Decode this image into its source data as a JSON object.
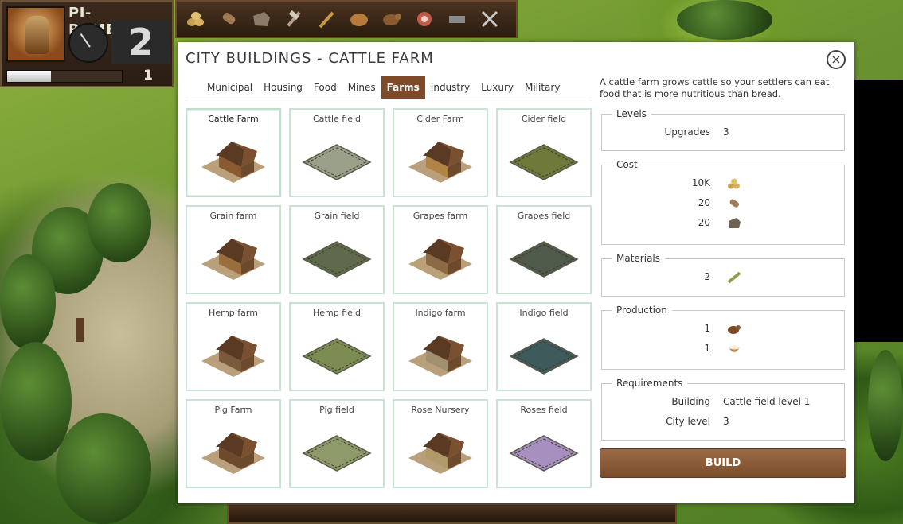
{
  "hud": {
    "city_name": "PI-RAMESSES",
    "level": "2",
    "sub_level": "1",
    "progress": 0.38
  },
  "resources": [
    {
      "name": "wood-logs-icon"
    },
    {
      "name": "log-icon"
    },
    {
      "name": "stone-icon"
    },
    {
      "name": "tools-icon"
    },
    {
      "name": "wheat-icon"
    },
    {
      "name": "bread-icon"
    },
    {
      "name": "cattle-icon"
    },
    {
      "name": "meat-icon"
    },
    {
      "name": "pipe-icon"
    },
    {
      "name": "swords-icon"
    }
  ],
  "dialog": {
    "title": "CITY BUILDINGS - CATTLE FARM",
    "close": "×",
    "tabs": [
      {
        "label": "Municipal",
        "active": false
      },
      {
        "label": "Housing",
        "active": false
      },
      {
        "label": "Food",
        "active": false
      },
      {
        "label": "Mines",
        "active": false
      },
      {
        "label": "Farms",
        "active": true
      },
      {
        "label": "Industry",
        "active": false
      },
      {
        "label": "Luxury",
        "active": false
      },
      {
        "label": "Military",
        "active": false
      }
    ],
    "buildings": [
      {
        "name": "Cattle Farm",
        "selected": true,
        "kind": "house",
        "color": "#8a5a33"
      },
      {
        "name": "Cattle field",
        "selected": false,
        "kind": "field",
        "color": "#9aa08a"
      },
      {
        "name": "Cider Farm",
        "selected": false,
        "kind": "house",
        "color": "#b18345"
      },
      {
        "name": "Cider field",
        "selected": false,
        "kind": "field",
        "color": "#6f7a3a"
      },
      {
        "name": "Grain farm",
        "selected": false,
        "kind": "house",
        "color": "#9a6d3c"
      },
      {
        "name": "Grain field",
        "selected": false,
        "kind": "field",
        "color": "#5f6a4a"
      },
      {
        "name": "Grapes farm",
        "selected": false,
        "kind": "house",
        "color": "#8c6a45"
      },
      {
        "name": "Grapes field",
        "selected": false,
        "kind": "field",
        "color": "#4f5a4a"
      },
      {
        "name": "Hemp farm",
        "selected": false,
        "kind": "house",
        "color": "#7a5a3c"
      },
      {
        "name": "Hemp field",
        "selected": false,
        "kind": "field",
        "color": "#7c8c52"
      },
      {
        "name": "Indigo farm",
        "selected": false,
        "kind": "house",
        "color": "#a09070"
      },
      {
        "name": "Indigo field",
        "selected": false,
        "kind": "field",
        "color": "#3f5a5a"
      },
      {
        "name": "Pig Farm",
        "selected": false,
        "kind": "house",
        "color": "#6e4a2c"
      },
      {
        "name": "Pig field",
        "selected": false,
        "kind": "field",
        "color": "#8f9a6a"
      },
      {
        "name": "Rose Nursery",
        "selected": false,
        "kind": "house",
        "color": "#b09a6a"
      },
      {
        "name": "Roses field",
        "selected": false,
        "kind": "field",
        "color": "#a78fc0"
      }
    ],
    "description": "A cattle farm grows cattle so your settlers can eat food that is more nutritious than bread.",
    "levels": {
      "legend": "Levels",
      "upgrades_label": "Upgrades",
      "upgrades_value": "3"
    },
    "cost": {
      "legend": "Cost",
      "items": [
        {
          "amount": "10K",
          "icon": "wood-logs-icon"
        },
        {
          "amount": "20",
          "icon": "log-icon"
        },
        {
          "amount": "20",
          "icon": "stone-icon"
        }
      ]
    },
    "materials": {
      "legend": "Materials",
      "items": [
        {
          "amount": "2",
          "icon": "rope-icon"
        }
      ]
    },
    "production": {
      "legend": "Production",
      "items": [
        {
          "amount": "1",
          "icon": "cattle-icon"
        },
        {
          "amount": "1",
          "icon": "milk-bowl-icon"
        }
      ]
    },
    "requirements": {
      "legend": "Requirements",
      "building_label": "Building",
      "building_value": "Cattle field level 1",
      "city_label": "City level",
      "city_value": "3"
    },
    "build_label": "BUILD"
  },
  "colors": {
    "tab_active": "#7e4a2a",
    "build_button": "#8a5a36",
    "card_border": "#c9e3d2"
  }
}
